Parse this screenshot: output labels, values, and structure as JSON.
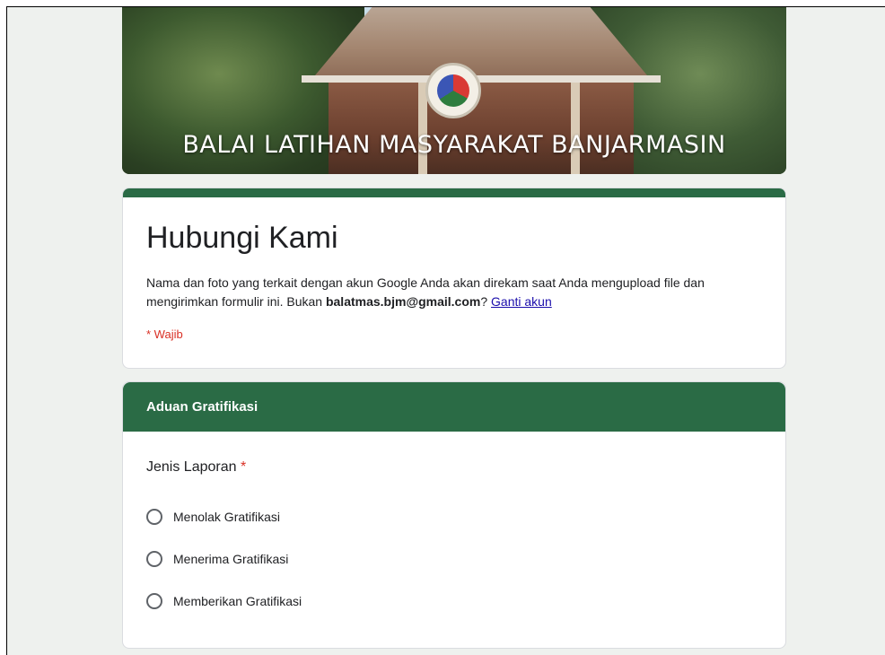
{
  "banner": {
    "title": "BALAI LATIHAN MASYARAKAT BANJARMASIN"
  },
  "form": {
    "title": "Hubungi Kami",
    "description_prefix": "Nama dan foto yang terkait dengan akun Google Anda akan direkam saat Anda mengupload file dan mengirimkan formulir ini. Bukan ",
    "account_email": "balatmas.bjm@gmail.com",
    "description_mid": "? ",
    "switch_account_link": "Ganti akun",
    "required_note": "* Wajib"
  },
  "section": {
    "title": "Aduan Gratifikasi",
    "question": {
      "label": "Jenis Laporan",
      "required_marker": "*",
      "options": [
        "Menolak Gratifikasi",
        "Menerima Gratifikasi",
        "Memberikan Gratifikasi"
      ]
    }
  },
  "colors": {
    "theme": "#2a6b45",
    "required": "#d93025",
    "background": "#eef1ee"
  }
}
